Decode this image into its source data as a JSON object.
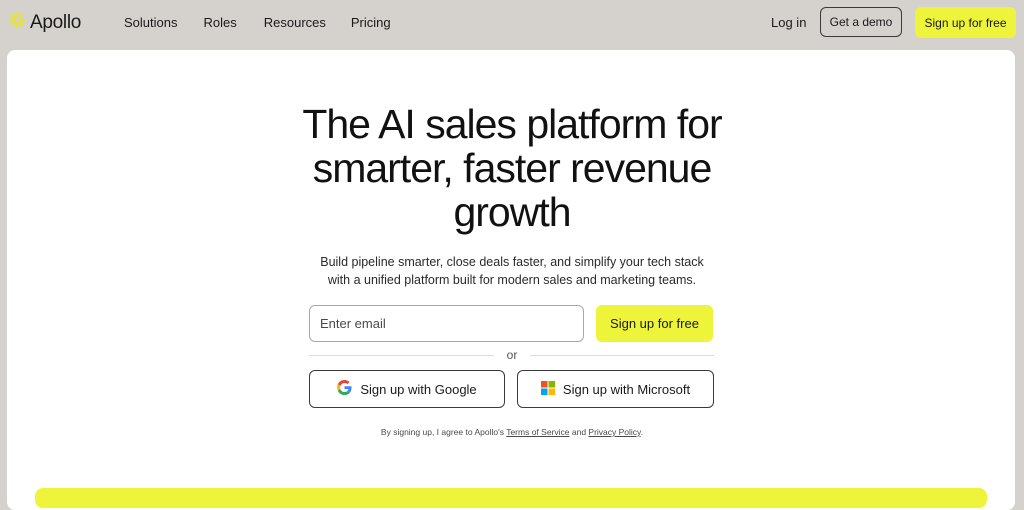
{
  "brand": {
    "name": "Apollo",
    "accent": "#eef43a",
    "logo_icon": "sunburst-logo-icon"
  },
  "nav": {
    "links": [
      "Solutions",
      "Roles",
      "Resources",
      "Pricing"
    ],
    "login": "Log in",
    "demo": "Get a demo",
    "signup": "Sign up for free"
  },
  "hero": {
    "headline_line1": "The AI sales platform for",
    "headline_line2": "smarter, faster revenue",
    "headline_line3": "growth",
    "subtext_line1": "Build pipeline smarter, close deals faster, and simplify your tech stack",
    "subtext_line2": "with a unified platform built for modern sales and marketing teams.",
    "email_placeholder": "Enter email",
    "signup": "Sign up for free",
    "or": "or",
    "google": "Sign up with Google",
    "microsoft": "Sign up with Microsoft",
    "legal_prefix": "By signing up, I agree to Apollo's ",
    "terms": "Terms of Service",
    "legal_and": " and ",
    "privacy": "Privacy Policy",
    "legal_suffix": "."
  }
}
